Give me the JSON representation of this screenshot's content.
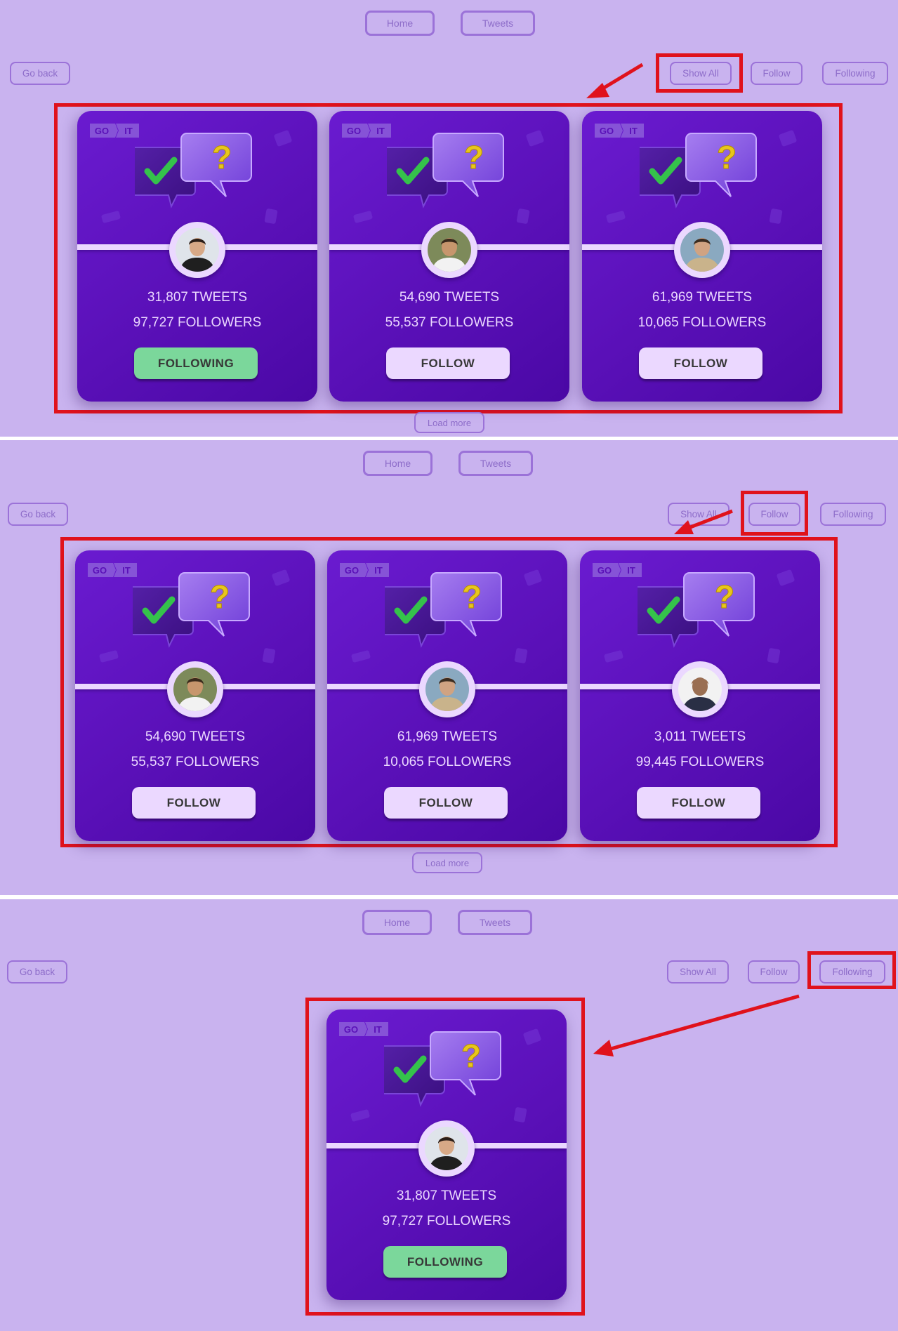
{
  "nav": {
    "home_label": "Home",
    "tweets_label": "Tweets"
  },
  "toolbar": {
    "back_label": "Go back",
    "show_all_label": "Show All",
    "follow_label": "Follow",
    "following_label": "Following"
  },
  "load_more_label": "Load more",
  "card_logo": {
    "left": "GO",
    "right": "IT"
  },
  "colors": {
    "background": "#c9b3ef",
    "card": "#5a10b8",
    "highlight": "#e0121c",
    "following_button": "#7bd79b",
    "follow_button": "#ebd8ff"
  },
  "panels": [
    {
      "active_filter": "Show All",
      "cards": [
        {
          "tweets": "31,807 TWEETS",
          "followers": "97,727 FOLLOWERS",
          "button": "FOLLOWING",
          "state": "following",
          "avatar": "avatar-man-dark-jacket"
        },
        {
          "tweets": "54,690 TWEETS",
          "followers": "55,537 FOLLOWERS",
          "button": "FOLLOW",
          "state": "follow",
          "avatar": "avatar-man-white-shirt"
        },
        {
          "tweets": "61,969 TWEETS",
          "followers": "10,065 FOLLOWERS",
          "button": "FOLLOW",
          "state": "follow",
          "avatar": "avatar-man-beard"
        }
      ]
    },
    {
      "active_filter": "Follow",
      "cards": [
        {
          "tweets": "54,690 TWEETS",
          "followers": "55,537 FOLLOWERS",
          "button": "FOLLOW",
          "state": "follow",
          "avatar": "avatar-man-white-shirt"
        },
        {
          "tweets": "61,969 TWEETS",
          "followers": "10,065 FOLLOWERS",
          "button": "FOLLOW",
          "state": "follow",
          "avatar": "avatar-man-beard"
        },
        {
          "tweets": "3,011 TWEETS",
          "followers": "99,445 FOLLOWERS",
          "button": "FOLLOW",
          "state": "follow",
          "avatar": "avatar-man-suit"
        }
      ]
    },
    {
      "active_filter": "Following",
      "cards": [
        {
          "tweets": "31,807 TWEETS",
          "followers": "97,727 FOLLOWERS",
          "button": "FOLLOWING",
          "state": "following",
          "avatar": "avatar-man-dark-jacket"
        }
      ]
    }
  ]
}
